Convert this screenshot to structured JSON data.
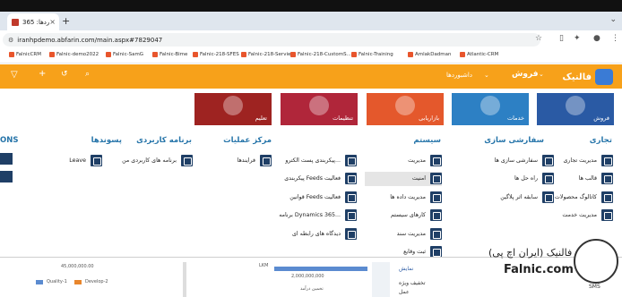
{
  "browser": {
    "tab_title": "داشبوردها: 365 Dynamics",
    "new_tab": "+",
    "url": "iranhpdemo.abfarin.com/main.aspx#7829047"
  },
  "bookmarks": [
    "FalnicCRM",
    "Falnic-demo2022",
    "Falnic-SamG",
    "Falnic-Bime",
    "Falnic-218-SFES",
    "Falnic-218-Servie",
    "Falnic-218-CustomS...",
    "Falnic-Training",
    "AmlakDadman",
    "Atlantic-CRM"
  ],
  "header": {
    "brand": "فالنیک",
    "section": "فروش",
    "breadcrumb": "داشبوردها"
  },
  "tiles": [
    {
      "label": "فروش",
      "color": "#2a5aa4"
    },
    {
      "label": "خدمات",
      "color": "#2d80c4"
    },
    {
      "label": "بازاریابی",
      "color": "#e4582c"
    },
    {
      "label": "تنظیمات",
      "color": "#b0263a"
    },
    {
      "label": "تعلیم",
      "color": "#9e2321"
    }
  ],
  "menu": {
    "business": {
      "title": "تجاری",
      "items": [
        "مدیریت تجاری",
        "قالب ها",
        "کاتالوگ محصولات",
        "مدیریت خدمت"
      ]
    },
    "customization": {
      "title": "سفارشی سازی",
      "items": [
        "سفارشی سازی ها",
        "راه حل ها",
        "سابقه اثر پلاگین"
      ]
    },
    "system": {
      "title": "سیستم",
      "items": [
        "مدیریت",
        "امنیت",
        "مدیریت داده ها",
        "کارهای سیستم",
        "مدیریت سند",
        "ثبت وقایع"
      ]
    },
    "process_center": {
      "title": "مرکز عملیات",
      "items": [
        "فرایندها"
      ],
      "extra": [
        "پیکربندی پست الکترو...",
        "پیکربندی Feeds فعالیت",
        "قوانین Feeds فعالیت",
        "برنامه Dynamics 365...",
        "دیدگاه های رابطه ای"
      ]
    },
    "app": {
      "title": "برنامه کاربردی",
      "items": [
        "برنامه های کاربردی من"
      ]
    },
    "extensions": {
      "title": "پسوندها",
      "items": [
        "Leave"
      ]
    },
    "ons": {
      "title": "ONS"
    }
  },
  "bottom": {
    "footer_brand": "فالنیک (ایران اچ پی)",
    "footer_url": "Falnic.com",
    "legend": [
      "Quality-1",
      "Develop-2"
    ],
    "axis_value": "2,000,000,000",
    "axis_label": "تخمین درآمد",
    "right_labels": [
      "نمایش",
      "تخفیف ویژه",
      "عمل",
      "SMS"
    ],
    "misc": "LKM",
    "left_value": "45,000,000.00"
  }
}
